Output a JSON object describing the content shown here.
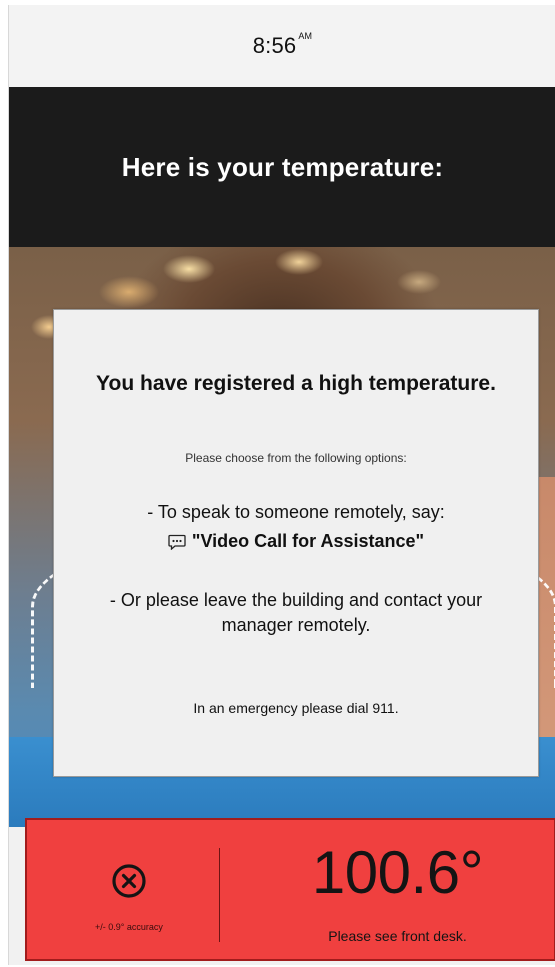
{
  "status_bar": {
    "time": "8:56",
    "meridiem": "AM"
  },
  "header": {
    "title": "Here is your temperature:"
  },
  "alert": {
    "title": "You have registered a high temperature.",
    "subtitle": "Please choose from the following options:",
    "option_speak": "- To speak to someone remotely, say:",
    "option_command": "\"Video Call for Assistance\"",
    "option_command_icon": "speech-bubble-icon",
    "option_leave": "- Or please leave the building and contact your manager remotely.",
    "emergency": "In an emergency please dial 911."
  },
  "temperature_panel": {
    "status_icon": "x-circle-icon",
    "accuracy": "+/- 0.9° accuracy",
    "value": "100.6°",
    "message": "Please see front desk.",
    "background_color": "#f0403f"
  }
}
